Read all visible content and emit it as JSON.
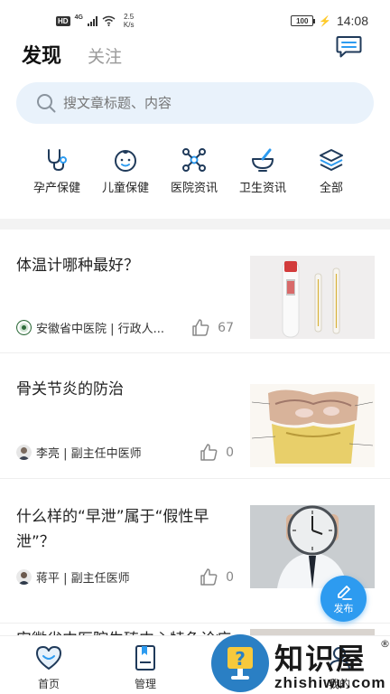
{
  "status_bar": {
    "network_badge": "HD",
    "network_type": "4G",
    "speed_value": "2.5",
    "speed_unit": "K/s",
    "battery": "100",
    "time": "14:08"
  },
  "header": {
    "tabs": [
      {
        "label": "发现",
        "active": true
      },
      {
        "label": "关注",
        "active": false
      }
    ],
    "message_icon": "chat-icon"
  },
  "search": {
    "placeholder": "搜文章标题、内容"
  },
  "categories": [
    {
      "label": "孕产保健",
      "icon": "stethoscope-icon"
    },
    {
      "label": "儿童保健",
      "icon": "baby-face-icon"
    },
    {
      "label": "医院资讯",
      "icon": "molecule-icon"
    },
    {
      "label": "卫生资讯",
      "icon": "mortar-pestle-icon"
    },
    {
      "label": "全部",
      "icon": "layers-icon"
    }
  ],
  "articles": [
    {
      "title": "体温计哪种最好？",
      "author": "安徽省中医院 | 行政人...",
      "likes": "67",
      "image": "thermometer-photo"
    },
    {
      "title": "骨关节炎的防治",
      "author": "李亮 | 副主任中医师",
      "likes": "0",
      "image": "knee-joint-illustration"
    },
    {
      "title": "什么样的“早泄”属于“假性早泄”？",
      "author": "蒋平 | 副主任医师",
      "likes": "0",
      "image": "man-holding-clock-photo"
    },
    {
      "title": "安徽省中医院生殖中心特色诊疗"
    }
  ],
  "fab": {
    "label": "发布",
    "icon": "pen-icon"
  },
  "bottom_nav": [
    {
      "label": "首页",
      "icon": "heart-smile-icon"
    },
    {
      "label": "管理",
      "icon": "notebook-icon"
    },
    {
      "label": "我的",
      "icon": "user-icon"
    }
  ],
  "watermark": {
    "brand": "知识屋",
    "registered": "®",
    "domain": "zhishiwu.com"
  },
  "colors": {
    "accent": "#2d9bf0",
    "search_bg": "#e9f2fb",
    "icon_stroke": "#1f3a5a",
    "watermark_blue": "#2a7fc4"
  }
}
